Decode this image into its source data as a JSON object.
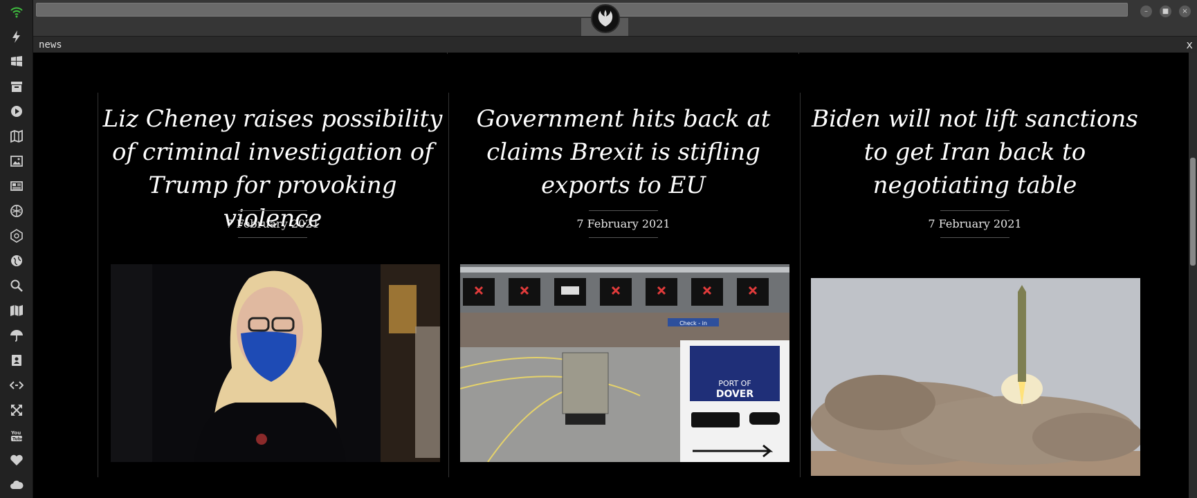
{
  "sidebar": {
    "icons": [
      "wifi-icon",
      "lightning-icon",
      "windows-icon",
      "archive-icon",
      "play-icon",
      "map-book-icon",
      "image-icon",
      "newspaper-icon",
      "jedi-icon",
      "empire-icon",
      "globe-icon",
      "search-icon",
      "map-icon",
      "umbrella-icon",
      "contacts-icon",
      "code-icon",
      "expand-icon",
      "youtube-icon",
      "heart-icon",
      "cloud-icon"
    ]
  },
  "window": {
    "minimize": "–",
    "maximize": "■",
    "close": "×"
  },
  "panel": {
    "title": "news",
    "close": "x"
  },
  "articles": [
    {
      "headline": "Liz Cheney raises possibility of criminal investigation of Trump for provoking violence",
      "date": "7 February 2021"
    },
    {
      "headline": "Government hits back at claims Brexit is stifling exports to EU",
      "date": "7 February 2021"
    },
    {
      "headline": "Biden will not lift sanctions to get Iran back to negotiating table",
      "date": "7 February 2021"
    }
  ],
  "sign": {
    "line1": "PORT OF",
    "line2": "DOVER",
    "checkin": "Check - in"
  },
  "colors": {
    "background": "#000000",
    "sidebar": "#222222",
    "wifi": "#3fbf3f"
  }
}
